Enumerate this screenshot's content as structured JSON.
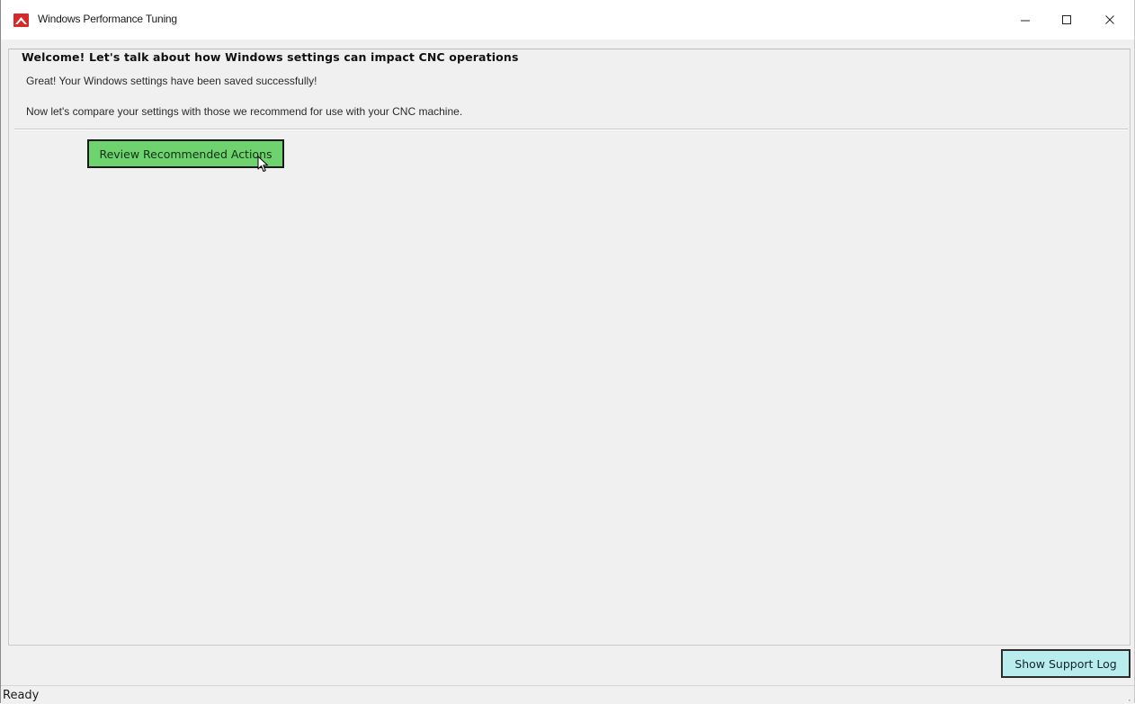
{
  "window": {
    "title": "Windows Performance Tuning",
    "icon": "app-logo-icon",
    "controls": {
      "minimize_icon": "minimize-icon",
      "maximize_icon": "maximize-icon",
      "close_icon": "close-icon"
    }
  },
  "welcome_group": {
    "title": "Welcome! Let's talk about how Windows settings can impact CNC operations",
    "message_saved": "Great! Your Windows settings have been saved successfully!",
    "message_compare": "Now let's compare your settings with those we recommend for use with your CNC machine.",
    "review_button_label": "Review Recommended Actions"
  },
  "footer": {
    "support_log_button_label": "Show Support Log"
  },
  "status_bar": {
    "status_text": "Ready"
  },
  "colors": {
    "review_button_bg": "#6ed36e",
    "support_button_bg": "#b9ecec",
    "app_icon_red": "#d62a2a",
    "window_bg": "#f0f0f0"
  }
}
